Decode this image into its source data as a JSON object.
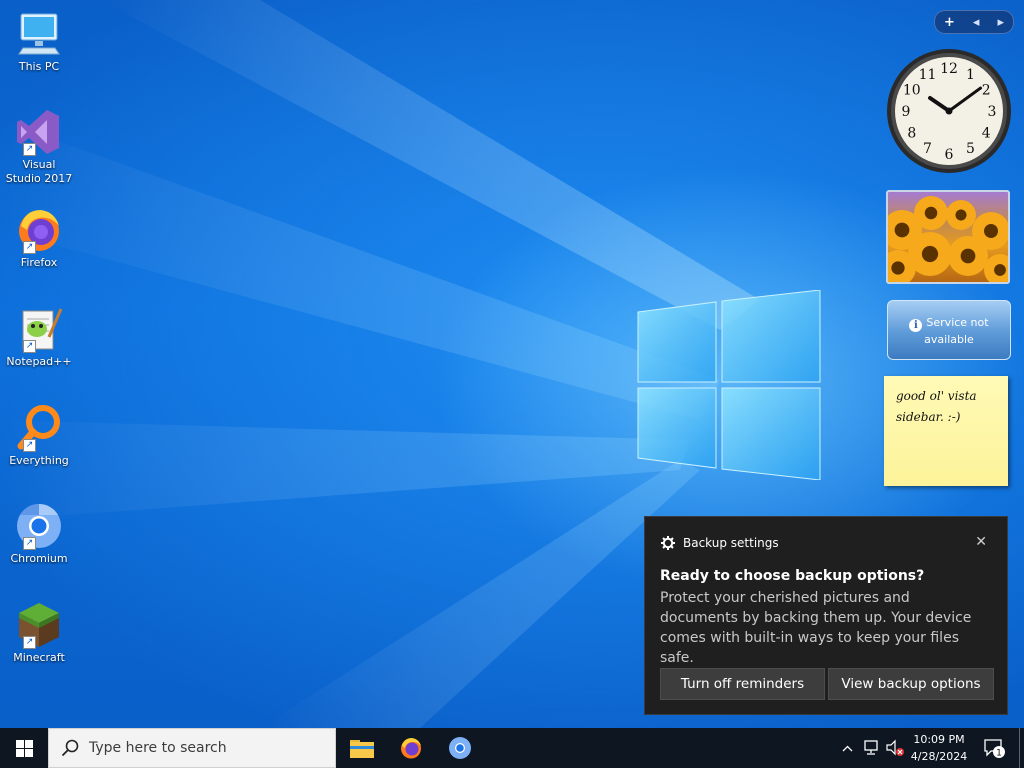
{
  "desktop": {
    "icons": [
      {
        "label": "This PC",
        "icon": "this-pc-icon"
      },
      {
        "label": "Visual Studio 2017",
        "icon": "visual-studio-icon"
      },
      {
        "label": "Firefox",
        "icon": "firefox-icon"
      },
      {
        "label": "Notepad++",
        "icon": "notepad-plus-plus-icon"
      },
      {
        "label": "Everything",
        "icon": "everything-icon"
      },
      {
        "label": "Chromium",
        "icon": "chromium-icon"
      },
      {
        "label": "Minecraft",
        "icon": "minecraft-icon"
      }
    ]
  },
  "sidebar": {
    "controls": {
      "add": "+",
      "prev": "◂",
      "next": "▸"
    },
    "clock": {
      "numerals": [
        "12",
        "1",
        "2",
        "3",
        "4",
        "5",
        "6",
        "7",
        "8",
        "9",
        "10",
        "11"
      ],
      "hour": 10,
      "minute": 9
    },
    "weather": {
      "message": "Service not available"
    },
    "note": {
      "text_line1": "good ol' vista",
      "text_line2": "sidebar. :-)"
    }
  },
  "toast": {
    "app": "Backup settings",
    "title": "Ready to choose backup options?",
    "body": "Protect your cherished pictures and documents by backing them up. Your device comes with built-in ways to keep your files safe.",
    "close_glyph": "✕",
    "buttons": {
      "dismiss": "Turn off reminders",
      "primary": "View backup options"
    }
  },
  "taskbar": {
    "search_placeholder": "Type here to search",
    "pinned": [
      "file-explorer-icon",
      "firefox-icon",
      "chromium-icon"
    ],
    "time": "10:09 PM",
    "date": "4/28/2024",
    "notification_count": "1"
  },
  "colors": {
    "accent": "#0a64d2",
    "taskbar": "#0e1621",
    "toast_bg": "#1f1f1f"
  }
}
